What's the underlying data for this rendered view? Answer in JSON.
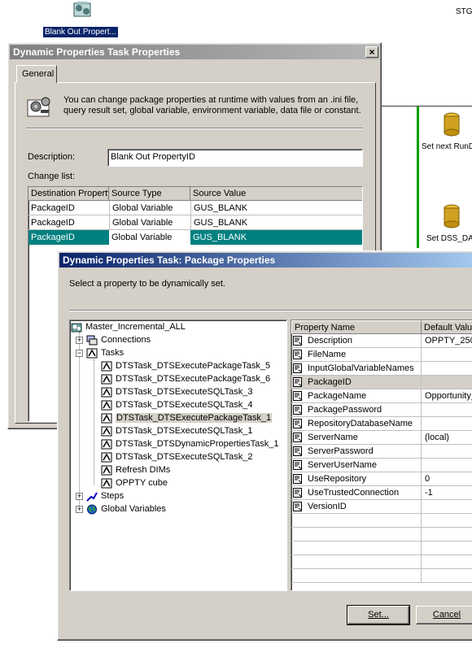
{
  "desktop": {
    "task_icon_label": "Blank Out Propert...",
    "top_right_text": "STG",
    "node1_label": "Set next RunD",
    "node2_label": "Set DSS_DA"
  },
  "dialog1": {
    "title": "Dynamic Properties Task Properties",
    "tab_general": "General",
    "intro_text": "You can change package properties at runtime with values from an .ini file, query result set, global variable, environment variable, data file or constant.",
    "description_label": "Description:",
    "description_value": "Blank Out PropertyID",
    "change_list_label": "Change list:",
    "columns": [
      "Destination Property",
      "Source Type",
      "Source Value"
    ],
    "rows": [
      [
        "PackageID",
        "Global Variable",
        "GUS_BLANK"
      ],
      [
        "PackageID",
        "Global Variable",
        "GUS_BLANK"
      ],
      [
        "PackageID",
        "Global Variable",
        "GUS_BLANK"
      ]
    ]
  },
  "dialog2": {
    "title": "Dynamic Properties Task: Package Properties",
    "instruction": "Select a property to be dynamically set.",
    "tree": {
      "root": "Master_Incremental_ALL",
      "connections": "Connections",
      "tasks": "Tasks",
      "task_items": [
        "DTSTask_DTSExecutePackageTask_5",
        "DTSTask_DTSExecutePackageTask_6",
        "DTSTask_DTSExecuteSQLTask_3",
        "DTSTask_DTSExecuteSQLTask_4",
        "DTSTask_DTSExecutePackageTask_1",
        "DTSTask_DTSExecuteSQLTask_1",
        "DTSTask_DTSDynamicPropertiesTask_1",
        "DTSTask_DTSExecuteSQLTask_2",
        "Refresh DIMs",
        "OPPTY cube"
      ],
      "steps": "Steps",
      "global_variables": "Global Variables"
    },
    "props": {
      "col_name": "Property Name",
      "col_value": "Default Valu",
      "rows": [
        {
          "name": "Description",
          "value": "OPPTY_250"
        },
        {
          "name": "FileName",
          "value": ""
        },
        {
          "name": "InputGlobalVariableNames",
          "value": ""
        },
        {
          "name": "PackageID",
          "value": ""
        },
        {
          "name": "PackageName",
          "value": "Opportunity_"
        },
        {
          "name": "PackagePassword",
          "value": ""
        },
        {
          "name": "RepositoryDatabaseName",
          "value": ""
        },
        {
          "name": "ServerName",
          "value": "(local)"
        },
        {
          "name": "ServerPassword",
          "value": ""
        },
        {
          "name": "ServerUserName",
          "value": ""
        },
        {
          "name": "UseRepository",
          "value": "0"
        },
        {
          "name": "UseTrustedConnection",
          "value": "-1"
        },
        {
          "name": "VersionID",
          "value": ""
        }
      ]
    },
    "set_button": "Set...",
    "cancel_button": "Cancel"
  }
}
